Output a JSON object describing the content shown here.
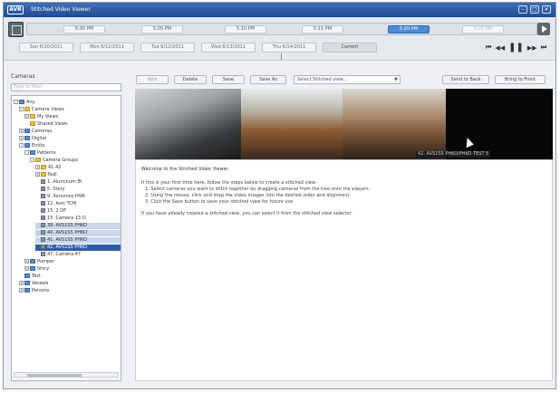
{
  "window": {
    "title": "Stitched Video Viewer",
    "logo_text": "AVR",
    "controls": [
      "–",
      "□",
      "✕"
    ]
  },
  "timeline": {
    "time_chips": [
      {
        "label": "5:00 PM",
        "state": "normal"
      },
      {
        "label": "5:05 PM",
        "state": "normal"
      },
      {
        "label": "5:10 PM",
        "state": "normal"
      },
      {
        "label": "5:15 PM",
        "state": "normal"
      },
      {
        "label": "5:20 PM",
        "state": "active"
      },
      {
        "label": "5:25 PM",
        "state": "faded"
      }
    ],
    "day_tabs": [
      {
        "label": "Sun 6/10/2011",
        "current": false
      },
      {
        "label": "Mon 6/11/2011",
        "current": false
      },
      {
        "label": "Tue 6/12/2011",
        "current": false
      },
      {
        "label": "Wed 6/13/2011",
        "current": false
      },
      {
        "label": "Thu 6/14/2011",
        "current": false
      },
      {
        "label": "Current",
        "current": true
      }
    ],
    "transport": [
      "⏮",
      "◀◀",
      "❚❚",
      "▶▶",
      "⏭"
    ]
  },
  "cameras_pane": {
    "label": "Cameras",
    "search_placeholder": "Type to filter",
    "tree": [
      {
        "label": "Any",
        "depth": 0,
        "icon": "blue",
        "tw": "-"
      },
      {
        "label": "Camera Views",
        "depth": 1,
        "icon": "folder",
        "tw": "-"
      },
      {
        "label": "My Views",
        "depth": 2,
        "icon": "folder",
        "tw": "+"
      },
      {
        "label": "Shared Views",
        "depth": 2,
        "icon": "folder",
        "tw": ""
      },
      {
        "label": "Cameras",
        "depth": 1,
        "icon": "blue",
        "tw": "+"
      },
      {
        "label": "Digital",
        "depth": 1,
        "icon": "blue",
        "tw": "+"
      },
      {
        "label": "Entity",
        "depth": 1,
        "icon": "blue",
        "tw": "-"
      },
      {
        "label": "Patterns",
        "depth": 2,
        "icon": "blue",
        "tw": "-"
      },
      {
        "label": "Camera Groups",
        "depth": 3,
        "icon": "folder",
        "tw": "-"
      },
      {
        "label": "41.42",
        "depth": 4,
        "icon": "folder",
        "tw": "+"
      },
      {
        "label": "Null",
        "depth": 4,
        "icon": "folder",
        "tw": "+"
      },
      {
        "label": "1. Aluminum Bl",
        "depth": 4,
        "icon": "cam",
        "tw": ""
      },
      {
        "label": "5. Story",
        "depth": 4,
        "icon": "cam",
        "tw": ""
      },
      {
        "label": "9. Xenomes HVR",
        "depth": 4,
        "icon": "cam",
        "tw": ""
      },
      {
        "label": "11. Axis TCM",
        "depth": 4,
        "icon": "cam",
        "tw": ""
      },
      {
        "label": "15. 2 OF",
        "depth": 4,
        "icon": "cam",
        "tw": ""
      },
      {
        "label": "15. Camera 13 O",
        "depth": 4,
        "icon": "cam",
        "tw": ""
      },
      {
        "label": "39. AVS1S5 PHKO",
        "depth": 4,
        "icon": "cam",
        "tw": "",
        "state": "sel"
      },
      {
        "label": "40. AVS1S5 PHKO",
        "depth": 4,
        "icon": "cam",
        "tw": "",
        "state": "sel"
      },
      {
        "label": "41. AVS1S5 PHKO",
        "depth": 4,
        "icon": "cam",
        "tw": "",
        "state": "sel"
      },
      {
        "label": "42. AVS1S5 PHKO",
        "depth": 4,
        "icon": "cam",
        "tw": "",
        "state": "sel2"
      },
      {
        "label": "47. Camera 47",
        "depth": 4,
        "icon": "cam",
        "tw": ""
      },
      {
        "label": "Pumper",
        "depth": 2,
        "icon": "blue",
        "tw": "+"
      },
      {
        "label": "Story",
        "depth": 2,
        "icon": "blue",
        "tw": "+"
      },
      {
        "label": "Test",
        "depth": 1,
        "icon": "blue",
        "tw": ""
      },
      {
        "label": "Vessels",
        "depth": 1,
        "icon": "blue",
        "tw": "+"
      },
      {
        "label": "Persons",
        "depth": 1,
        "icon": "blue",
        "tw": "+"
      }
    ]
  },
  "toolbar": {
    "new_label": "New",
    "delete_label": "Delete",
    "save_label": "Save",
    "save_as_label": "Save As",
    "view_select_value": "Select Stitched view...",
    "send_back_label": "Send to Back",
    "bring_front_label": "Bring to Front"
  },
  "video": {
    "caption": "42. AVS1S5 PHKO/PHKO TEST 5"
  },
  "instructions": {
    "welcome": "Welcome to the Stitched Video Viewer.",
    "lines": [
      "If this is your first time here, follow the steps below to create a stitched view.",
      "1. Select cameras you want to stitch together by dragging cameras from the tree onto the players.",
      "2. Using the mouse, click and drag the video images into the desired order and alignment.",
      "3. Click the Save button to save your stitched view for future use."
    ],
    "existing": "If you have already created a stitched view, you can select it from the stitched view selector."
  },
  "colors": {
    "titlebar": "#2a5aa3",
    "active_chip": "#4f8bd6",
    "selection": "#2f5ea7"
  }
}
